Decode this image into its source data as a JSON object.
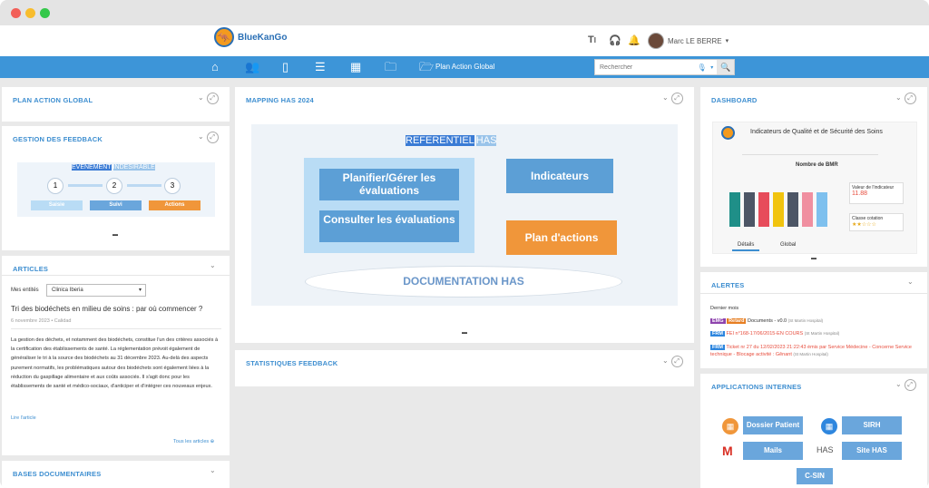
{
  "app": {
    "logo_text": "BlueKanGo",
    "user_name": "Marc LE BERRE",
    "top_icons": [
      "text-size-icon",
      "headset-icon",
      "bell-icon"
    ]
  },
  "nav": {
    "icons": [
      "home-icon",
      "users-icon",
      "tablet-icon",
      "list-icon",
      "calendar-icon",
      "folder-icon",
      "folder-open-icon"
    ],
    "active_label": "Plan Action Global",
    "search_placeholder": "Rechercher"
  },
  "panels": {
    "plan_action": {
      "title": "PLAN ACTION GLOBAL"
    },
    "gestion_feedback": {
      "title": "GESTION DES FEEDBACK",
      "banner_a": "EVENEMENT",
      "banner_b": "INDESIRABLE",
      "steps": [
        "1",
        "2",
        "3"
      ],
      "step_labels": [
        "Saisie",
        "Suivi",
        "Actions"
      ],
      "dots": "▬"
    },
    "articles": {
      "title": "ARTICLES",
      "filter_label": "Mes entités",
      "filter_value": "Clinica Iberia",
      "headline": "Tri des biodéchets en milieu de soins : par où commencer ?",
      "date": "6 novembre 2023",
      "category": "Calidad",
      "body": "La gestion des déchets, et notamment des biodéchets, constitue l'un des critères associés à la certification des établissements de santé. La réglementation prévoit également de généraliser le tri à la source des biodéchets au 31 décembre 2023. Au-delà des aspects purement normatifs, les problématiques autour des biodéchets sont également liées à la réduction du gaspillage alimentaire et aux coûts associés. Il s'agit donc pour les établissements de santé et médico-sociaux, d'anticiper et d'intégrer ces nouveaux enjeux.",
      "read_link": "Lire l'article",
      "all_link": "Tous les articles"
    },
    "bases": {
      "title": "BASES DOCUMENTAIRES"
    },
    "mapping": {
      "title": "MAPPING HAS 2024",
      "ref_a": "REFERENTIEL",
      "ref_b": "HAS",
      "btn_plan": "Planifier/Gérer les évaluations",
      "btn_consult": "Consulter les évaluations",
      "btn_indic": "Indicateurs",
      "btn_actions": "Plan d'actions",
      "doc": "DOCUMENTATION HAS",
      "dots": "▬"
    },
    "stats": {
      "title": "STATISTIQUES FEEDBACK"
    },
    "dashboard": {
      "title": "DASHBOARD",
      "card_title": "Indicateurs de Qualité et de Sécurité des Soins",
      "chart_title": "Nombre de BMR",
      "kpi_label": "Valeur de l'indicateur",
      "kpi_value": "11.88",
      "kpi2_label": "Classe cotation",
      "kpi2_stars": "★★☆☆☆",
      "tab_details": "Détails",
      "tab_global": "Global",
      "dots": "▬"
    },
    "alertes": {
      "title": "ALERTES",
      "subtitle": "Dernier mois",
      "items": [
        {
          "tag": "EMG",
          "tag2": "Retard",
          "text": "Documents - v0.0",
          "place": "(St Martin Hospital)"
        },
        {
          "tag": "FRM",
          "text": "FEI n°168-17/06/2015-EN COURS",
          "place": "(St Martin Hospital)"
        },
        {
          "tag": "FRM",
          "text": "Ticket nr 27 du 12/02/2023 21:22:43 émis par Service Médecine - Concerne Service technique - Blocage activité : Gênant",
          "place": "(St Martin Hospital)"
        }
      ]
    },
    "apps": {
      "title": "APPLICATIONS INTERNES",
      "buttons": [
        "Dossier Patient",
        "SIRH",
        "Mails",
        "Site HAS"
      ],
      "extra_logo": "C-SIN",
      "has_logo": "HAS"
    }
  },
  "colors": {
    "nav_blue": "#3d95d8",
    "panel_title": "#3d8ed0",
    "box_blue": "#5c9fd6",
    "box_orange": "#f0963a",
    "light_blue": "#b9dcf5"
  }
}
